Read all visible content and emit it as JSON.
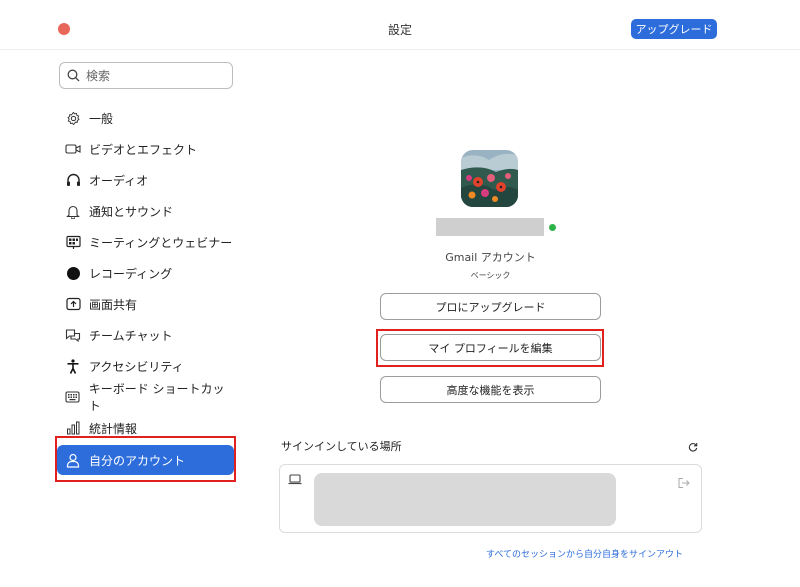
{
  "window": {
    "title": "設定",
    "upgrade_label": "アップグレード"
  },
  "search": {
    "placeholder": "検索"
  },
  "sidebar": {
    "items": [
      {
        "label": "一般",
        "icon": "gear-icon"
      },
      {
        "label": "ビデオとエフェクト",
        "icon": "video-camera-icon"
      },
      {
        "label": "オーディオ",
        "icon": "headphones-icon"
      },
      {
        "label": "通知とサウンド",
        "icon": "bell-icon"
      },
      {
        "label": "ミーティングとウェビナー",
        "icon": "meeting-icon"
      },
      {
        "label": "レコーディング",
        "icon": "record-icon"
      },
      {
        "label": "画面共有",
        "icon": "share-screen-icon"
      },
      {
        "label": "チームチャット",
        "icon": "chat-bubbles-icon"
      },
      {
        "label": "アクセシビリティ",
        "icon": "accessibility-icon"
      },
      {
        "label": "キーボード ショートカット",
        "icon": "keyboard-icon"
      },
      {
        "label": "統計情報",
        "icon": "bar-chart-icon"
      },
      {
        "label": "自分のアカウント",
        "icon": "person-icon",
        "selected": true
      }
    ]
  },
  "profile": {
    "account_type": "Gmail アカウント",
    "plan": "ベーシック",
    "status_color": "#2bb34a"
  },
  "buttons": {
    "upgrade_pro": "プロにアップグレード",
    "edit_profile": "マイ プロフィールを編集",
    "advanced": "高度な機能を表示"
  },
  "sessions": {
    "title": "サインインしている場所",
    "signout_all": "すべてのセッションから自分自身をサインアウト"
  },
  "colors": {
    "accent": "#2d6ddb",
    "highlight": "#e0211e"
  }
}
